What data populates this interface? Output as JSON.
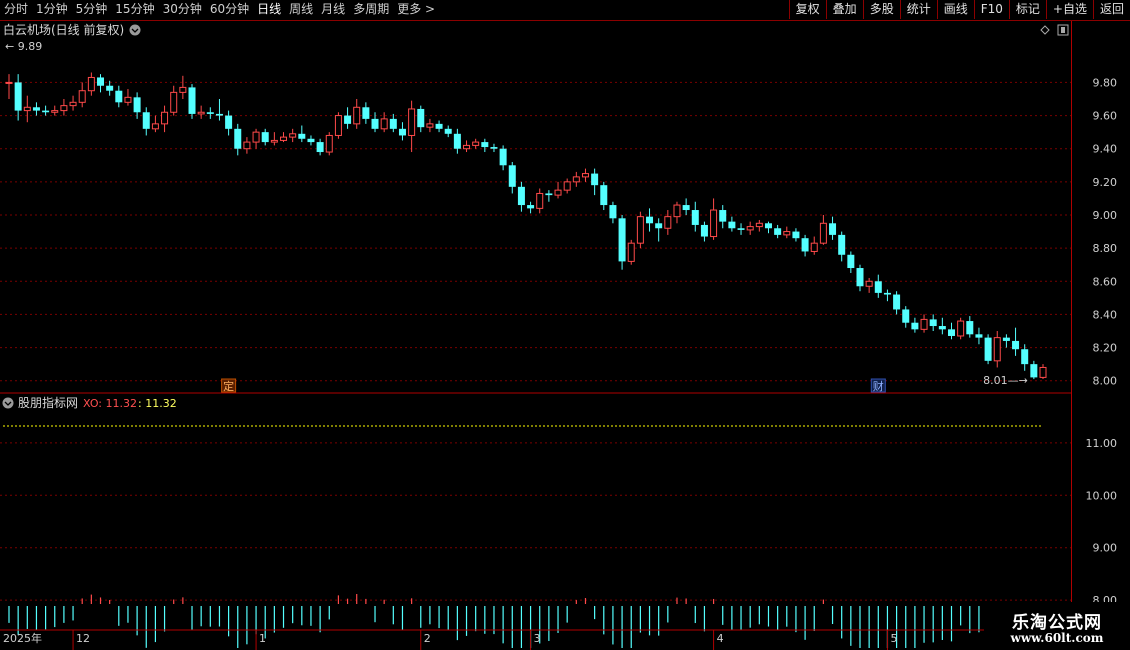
{
  "toolbar": {
    "periods": [
      "分时",
      "1分钟",
      "5分钟",
      "15分钟",
      "30分钟",
      "60分钟",
      "日线",
      "周线",
      "月线",
      "多周期",
      "更多 >"
    ],
    "active_period": "日线",
    "tools": [
      "复权",
      "叠加",
      "多股",
      "统计",
      "画线",
      "F10",
      "标记",
      "+自选",
      "返回"
    ]
  },
  "main_panel": {
    "title": "白云机场(日线 前复权)",
    "high_label": "9.89",
    "low_label": "8.01",
    "price_axis": [
      "9.80",
      "9.60",
      "9.40",
      "9.20",
      "9.00",
      "8.80",
      "8.60",
      "8.40",
      "8.20",
      "8.00"
    ],
    "markers": [
      {
        "text": "定",
        "index": 24
      },
      {
        "text": "财",
        "index": 95
      }
    ]
  },
  "indicator_panel": {
    "name": "股朋指标网",
    "var_label": "XO: 11.32",
    "var_value": ": 11.32",
    "axis": [
      "11.00",
      "10.00",
      "9.00",
      "8.00"
    ]
  },
  "time_axis": {
    "year": "2025年",
    "months": [
      {
        "label": "12",
        "index": 7
      },
      {
        "label": "1",
        "index": 27
      },
      {
        "label": "2",
        "index": 45
      },
      {
        "label": "3",
        "index": 57
      },
      {
        "label": "4",
        "index": 77
      },
      {
        "label": "5",
        "index": 96
      }
    ]
  },
  "watermark": {
    "name": "乐淘公式网",
    "url": "www.60lt.com"
  },
  "colors": {
    "up": "#ff4a4a",
    "down": "#54ffff",
    "grid": "#7a0000",
    "axis": "#b00000",
    "yellow": "#ffff00"
  },
  "chart_data": {
    "type": "candlestick",
    "ylim": [
      7.95,
      10.05
    ],
    "candles": [
      [
        9.8,
        9.8,
        9.85,
        9.7
      ],
      [
        9.8,
        9.63,
        9.85,
        9.57
      ],
      [
        9.63,
        9.65,
        9.72,
        9.56
      ],
      [
        9.65,
        9.63,
        9.68,
        9.6
      ],
      [
        9.63,
        9.62,
        9.66,
        9.6
      ],
      [
        9.62,
        9.63,
        9.66,
        9.6
      ],
      [
        9.63,
        9.66,
        9.7,
        9.6
      ],
      [
        9.66,
        9.68,
        9.72,
        9.63
      ],
      [
        9.68,
        9.75,
        9.8,
        9.65
      ],
      [
        9.75,
        9.83,
        9.86,
        9.72
      ],
      [
        9.83,
        9.78,
        9.85,
        9.74
      ],
      [
        9.78,
        9.75,
        9.81,
        9.72
      ],
      [
        9.75,
        9.68,
        9.78,
        9.65
      ],
      [
        9.68,
        9.71,
        9.76,
        9.66
      ],
      [
        9.71,
        9.62,
        9.74,
        9.58
      ],
      [
        9.62,
        9.52,
        9.65,
        9.48
      ],
      [
        9.52,
        9.55,
        9.6,
        9.5
      ],
      [
        9.55,
        9.62,
        9.66,
        9.5
      ],
      [
        9.62,
        9.74,
        9.78,
        9.6
      ],
      [
        9.74,
        9.77,
        9.84,
        9.7
      ],
      [
        9.77,
        9.61,
        9.79,
        9.58
      ],
      [
        9.61,
        9.62,
        9.66,
        9.58
      ],
      [
        9.62,
        9.61,
        9.65,
        9.58
      ],
      [
        9.61,
        9.6,
        9.7,
        9.57
      ],
      [
        9.6,
        9.52,
        9.63,
        9.48
      ],
      [
        9.52,
        9.4,
        9.55,
        9.36
      ],
      [
        9.4,
        9.44,
        9.47,
        9.37
      ],
      [
        9.44,
        9.5,
        9.52,
        9.4
      ],
      [
        9.5,
        9.44,
        9.52,
        9.42
      ],
      [
        9.44,
        9.45,
        9.5,
        9.42
      ],
      [
        9.45,
        9.47,
        9.5,
        9.44
      ],
      [
        9.47,
        9.49,
        9.52,
        9.44
      ],
      [
        9.49,
        9.46,
        9.54,
        9.44
      ],
      [
        9.46,
        9.44,
        9.48,
        9.42
      ],
      [
        9.44,
        9.38,
        9.46,
        9.36
      ],
      [
        9.38,
        9.48,
        9.5,
        9.36
      ],
      [
        9.48,
        9.6,
        9.62,
        9.46
      ],
      [
        9.6,
        9.55,
        9.65,
        9.52
      ],
      [
        9.55,
        9.65,
        9.7,
        9.52
      ],
      [
        9.65,
        9.58,
        9.68,
        9.55
      ],
      [
        9.58,
        9.52,
        9.62,
        9.5
      ],
      [
        9.52,
        9.58,
        9.62,
        9.5
      ],
      [
        9.58,
        9.52,
        9.61,
        9.5
      ],
      [
        9.52,
        9.48,
        9.56,
        9.45
      ],
      [
        9.48,
        9.64,
        9.69,
        9.38
      ],
      [
        9.64,
        9.53,
        9.66,
        9.5
      ],
      [
        9.53,
        9.55,
        9.58,
        9.5
      ],
      [
        9.55,
        9.52,
        9.57,
        9.5
      ],
      [
        9.52,
        9.49,
        9.54,
        9.47
      ],
      [
        9.49,
        9.4,
        9.52,
        9.37
      ],
      [
        9.4,
        9.42,
        9.45,
        9.38
      ],
      [
        9.42,
        9.44,
        9.46,
        9.4
      ],
      [
        9.44,
        9.41,
        9.46,
        9.38
      ],
      [
        9.41,
        9.4,
        9.43,
        9.38
      ],
      [
        9.4,
        9.3,
        9.42,
        9.27
      ],
      [
        9.3,
        9.17,
        9.32,
        9.13
      ],
      [
        9.17,
        9.06,
        9.2,
        9.02
      ],
      [
        9.06,
        9.04,
        9.08,
        9.01
      ],
      [
        9.04,
        9.13,
        9.16,
        9.01
      ],
      [
        9.13,
        9.12,
        9.15,
        9.08
      ],
      [
        9.12,
        9.15,
        9.2,
        9.1
      ],
      [
        9.15,
        9.2,
        9.22,
        9.13
      ],
      [
        9.2,
        9.23,
        9.26,
        9.17
      ],
      [
        9.23,
        9.25,
        9.28,
        9.2
      ],
      [
        9.25,
        9.18,
        9.28,
        9.12
      ],
      [
        9.18,
        9.06,
        9.2,
        9.03
      ],
      [
        9.06,
        8.98,
        9.08,
        8.95
      ],
      [
        8.98,
        8.72,
        9.0,
        8.67
      ],
      [
        8.72,
        8.83,
        8.85,
        8.7
      ],
      [
        8.83,
        8.99,
        9.02,
        8.8
      ],
      [
        8.99,
        8.95,
        9.04,
        8.9
      ],
      [
        8.95,
        8.92,
        8.98,
        8.84
      ],
      [
        8.92,
        8.99,
        9.03,
        8.88
      ],
      [
        8.99,
        9.06,
        9.08,
        8.95
      ],
      [
        9.06,
        9.03,
        9.1,
        9.0
      ],
      [
        9.03,
        8.94,
        9.08,
        8.9
      ],
      [
        8.94,
        8.87,
        8.96,
        8.84
      ],
      [
        8.87,
        9.03,
        9.1,
        8.85
      ],
      [
        9.03,
        8.96,
        9.06,
        8.92
      ],
      [
        8.96,
        8.92,
        8.99,
        8.9
      ],
      [
        8.92,
        8.91,
        8.95,
        8.88
      ],
      [
        8.91,
        8.93,
        8.96,
        8.88
      ],
      [
        8.93,
        8.95,
        8.97,
        8.9
      ],
      [
        8.95,
        8.92,
        8.96,
        8.89
      ],
      [
        8.92,
        8.88,
        8.94,
        8.86
      ],
      [
        8.88,
        8.9,
        8.93,
        8.86
      ],
      [
        8.9,
        8.86,
        8.92,
        8.84
      ],
      [
        8.86,
        8.78,
        8.88,
        8.75
      ],
      [
        8.78,
        8.83,
        8.87,
        8.76
      ],
      [
        8.83,
        8.95,
        9.0,
        8.82
      ],
      [
        8.95,
        8.88,
        8.99,
        8.85
      ],
      [
        8.88,
        8.76,
        8.9,
        8.72
      ],
      [
        8.76,
        8.68,
        8.78,
        8.65
      ],
      [
        8.68,
        8.57,
        8.7,
        8.54
      ],
      [
        8.57,
        8.6,
        8.62,
        8.53
      ],
      [
        8.6,
        8.53,
        8.64,
        8.5
      ],
      [
        8.53,
        8.52,
        8.55,
        8.48
      ],
      [
        8.52,
        8.43,
        8.54,
        8.4
      ],
      [
        8.43,
        8.35,
        8.45,
        8.32
      ],
      [
        8.35,
        8.31,
        8.38,
        8.29
      ],
      [
        8.31,
        8.37,
        8.4,
        8.29
      ],
      [
        8.37,
        8.33,
        8.4,
        8.3
      ],
      [
        8.33,
        8.31,
        8.38,
        8.28
      ],
      [
        8.31,
        8.27,
        8.35,
        8.25
      ],
      [
        8.27,
        8.36,
        8.38,
        8.25
      ],
      [
        8.36,
        8.28,
        8.39,
        8.26
      ],
      [
        8.28,
        8.26,
        8.32,
        8.22
      ],
      [
        8.26,
        8.12,
        8.28,
        8.1
      ],
      [
        8.12,
        8.26,
        8.3,
        8.08
      ],
      [
        8.26,
        8.24,
        8.28,
        8.2
      ],
      [
        8.24,
        8.19,
        8.32,
        8.15
      ],
      [
        8.19,
        8.1,
        8.22,
        8.06
      ],
      [
        8.1,
        8.02,
        8.12,
        8.01
      ],
      [
        8.02,
        8.08,
        8.1,
        8.01
      ]
    ],
    "indicator_line": 11.32,
    "indicator_axis_ylim": [
      7.45,
      11.95
    ]
  }
}
